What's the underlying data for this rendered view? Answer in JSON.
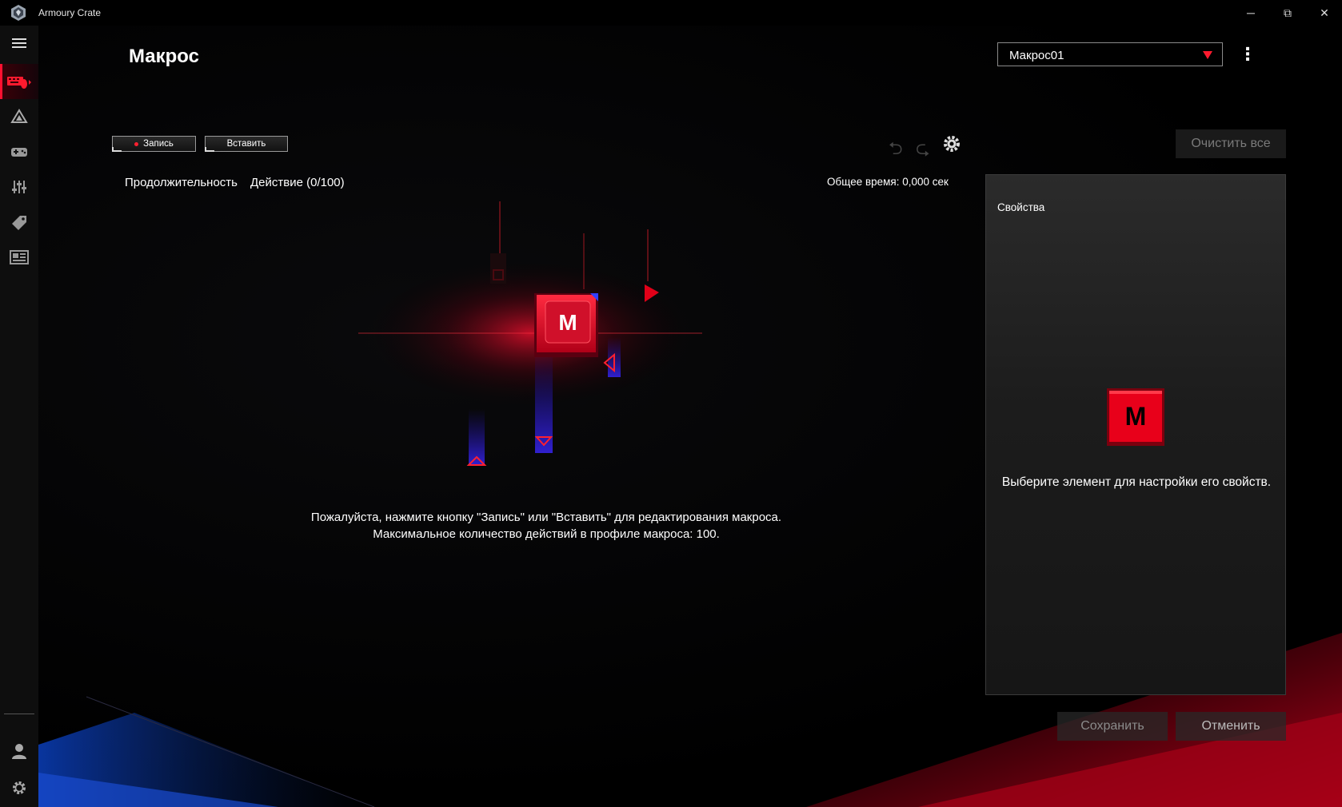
{
  "window": {
    "title": "Armoury Crate",
    "controls": {
      "minimize": "─",
      "maximize": "⧉",
      "close": "✕"
    }
  },
  "sidebar": {
    "items": [
      {
        "name": "menu",
        "icon": "hamburger-menu-icon"
      },
      {
        "name": "keyboard",
        "icon": "keyboard-mouse-icon",
        "active": true
      },
      {
        "name": "aura",
        "icon": "aura-triangle-icon"
      },
      {
        "name": "game",
        "icon": "gamepad-icon"
      },
      {
        "name": "tuning",
        "icon": "sliders-icon"
      },
      {
        "name": "deals",
        "icon": "tag-icon"
      },
      {
        "name": "news",
        "icon": "news-icon"
      },
      {
        "name": "account",
        "icon": "user-icon"
      },
      {
        "name": "settings",
        "icon": "gear-icon"
      }
    ]
  },
  "header": {
    "title": "Макрос"
  },
  "profile": {
    "selected": "Макрос01"
  },
  "toolbar": {
    "record_label": "Запись",
    "insert_label": "Вставить",
    "clear_all_label": "Очистить все"
  },
  "table": {
    "duration_header": "Продолжительность",
    "action_header": "Действие (0/100)",
    "total_time": "Общее время: 0,000 сек"
  },
  "empty_state": {
    "key_letter": "M",
    "line1": "Пожалуйста, нажмите кнопку \"Запись\" или \"Вставить\" для редактирования макроса.",
    "line2": "Максимальное количество действий в профиле макроса: 100."
  },
  "properties": {
    "title": "Свойства",
    "key_letter": "M",
    "hint": "Выберите элемент для настройки его свойств."
  },
  "footer": {
    "save_label": "Сохранить",
    "cancel_label": "Отменить"
  },
  "colors": {
    "accent": "#ff1a2e",
    "background": "#000000",
    "panel": "#1c1c1c"
  }
}
